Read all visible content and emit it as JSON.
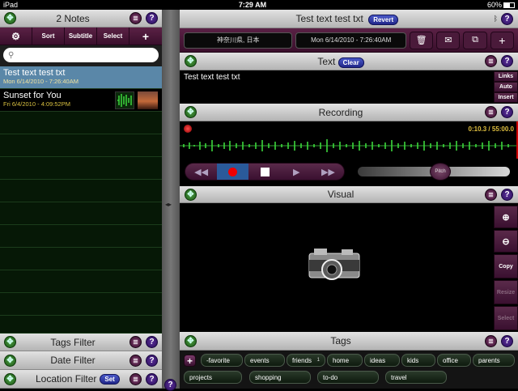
{
  "status": {
    "device": "iPad",
    "time": "7:29 AM",
    "battery": "60%"
  },
  "left": {
    "header_title": "2 Notes",
    "toolbar": [
      "Sort",
      "Subtitle",
      "Select"
    ],
    "search_placeholder": "",
    "notes": [
      {
        "title": "Test text test txt",
        "date": "Mon 6/14/2010 - 7:26:40AM"
      },
      {
        "title": "Sunset for You",
        "date": "Fri 6/4/2010 - 4:09:52PM"
      }
    ],
    "filters": {
      "tags": "Tags Filter",
      "date": "Date Filter",
      "location": "Location Filter",
      "set": "Set"
    }
  },
  "right": {
    "note_title": "Test text test txt",
    "revert": "Revert",
    "location": "神奈川県, 日本",
    "datetime": "Mon 6/14/2010 - 7:26:40AM",
    "text_section": {
      "title": "Text",
      "clear": "Clear",
      "content": "Test text test txt",
      "side": [
        "Links",
        "Auto",
        "Insert"
      ]
    },
    "recording": {
      "title": "Recording",
      "time": "0:10.3 / 55:00.0",
      "pitch": "Pitch",
      "pitch_level": 0.55
    },
    "visual": {
      "title": "Visual",
      "side": [
        "",
        "",
        "Copy",
        "Resize",
        "Select"
      ]
    },
    "tags": {
      "title": "Tags",
      "items": [
        {
          "name": "-favorite",
          "count": ""
        },
        {
          "name": "events",
          "count": ""
        },
        {
          "name": "friends",
          "count": "1"
        },
        {
          "name": "home",
          "count": ""
        },
        {
          "name": "ideas",
          "count": ""
        },
        {
          "name": "kids",
          "count": ""
        },
        {
          "name": "office",
          "count": ""
        },
        {
          "name": "parents",
          "count": ""
        },
        {
          "name": "projects",
          "count": ""
        },
        {
          "name": "shopping",
          "count": ""
        },
        {
          "name": "to-do",
          "count": ""
        },
        {
          "name": "travel",
          "count": ""
        }
      ]
    }
  }
}
